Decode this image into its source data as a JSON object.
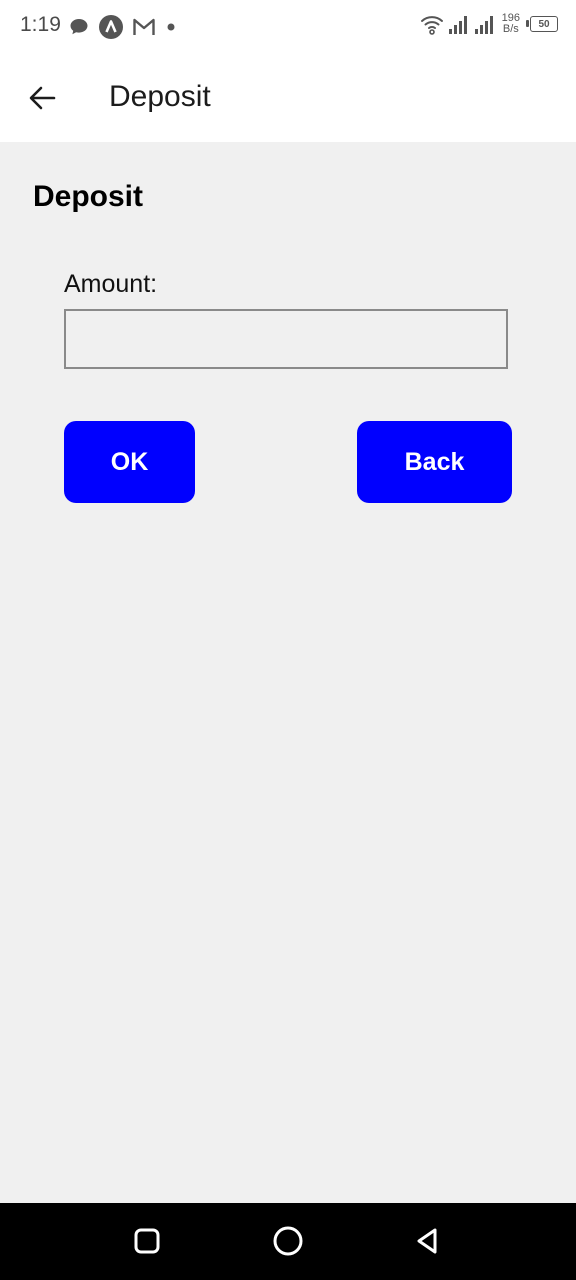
{
  "status_bar": {
    "time": "1:19",
    "net_speed_value": "196",
    "net_speed_unit": "B/s",
    "battery_level": "50"
  },
  "app_bar": {
    "title": "Deposit"
  },
  "form": {
    "heading": "Deposit",
    "amount_label": "Amount:",
    "amount_value": "",
    "ok_label": "OK",
    "back_label": "Back"
  },
  "colors": {
    "button_blue": "#0000ff",
    "background": "#f0f0f0"
  }
}
